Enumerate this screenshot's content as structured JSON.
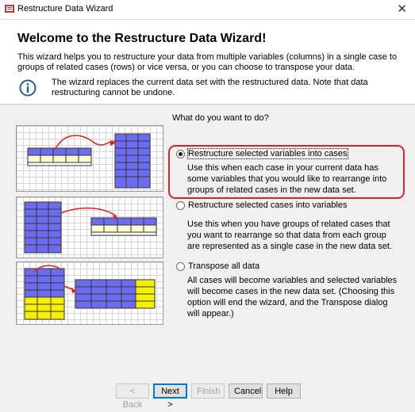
{
  "window": {
    "title": "Restructure Data Wizard",
    "close_glyph": "✕"
  },
  "header": {
    "heading": "Welcome to the Restructure Data Wizard!",
    "intro": "This wizard helps you to restructure your data from multiple variables (columns) in a single case to groups of related cases (rows) or vice versa, or you can choose to transpose your data.",
    "info_icon": "info-circle-icon",
    "info_text": "The wizard replaces the current data set with the restructured data.  Note that data restructuring cannot be undone."
  },
  "main": {
    "question": "What do you want to do?",
    "options": [
      {
        "label": "Restructure selected variables into cases",
        "selected": true,
        "description": "Use this when each case in your current data has some variables that you would like to rearrange into groups of related cases in the new data set."
      },
      {
        "label": "Restructure selected cases into variables",
        "selected": false,
        "description": "Use this when you have groups of related cases that you want to rearrange so that data from each group are represented as a single case in the new data set."
      },
      {
        "label": "Transpose all data",
        "selected": false,
        "description": "All cases will become variables and selected variables will become cases in the new data set. (Choosing this option will end the wizard, and the Transpose dialog will appear.)"
      }
    ]
  },
  "buttons": {
    "back": "< Back",
    "next": "Next >",
    "finish": "Finish",
    "cancel": "Cancel",
    "help": "Help"
  },
  "colors": {
    "highlight": "#d9232b",
    "table_blue": "#6c6cf0",
    "table_yellow": "#f5f000",
    "arrow": "#e0201c"
  }
}
